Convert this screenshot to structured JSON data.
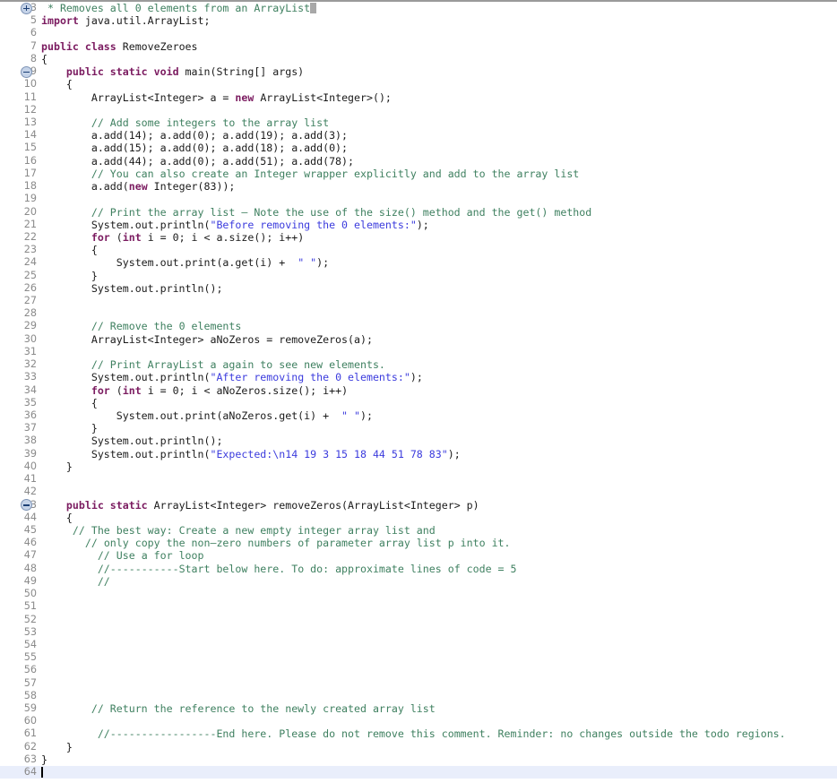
{
  "editor": {
    "language": "java",
    "colors": {
      "background": "#ffffff",
      "plain_text": "#1a1a1a",
      "keyword": "#7b1b60",
      "comment": "#3f8060",
      "string": "#3b3bdd",
      "line_number": "#8a8a8a",
      "current_line_highlight": "#e9eefb",
      "fold_marker": "#c5d3e8"
    },
    "caret_line": "64",
    "lines": [
      {
        "num": "3",
        "fold": "expand",
        "segments": [
          {
            "t": " * Removes all 0 elements from an ArrayList",
            "c": "cm"
          },
          {
            "t": "",
            "c": "cursor-block"
          }
        ]
      },
      {
        "num": "5",
        "fold": "",
        "segments": [
          {
            "t": "import",
            "c": "kw"
          },
          {
            "t": " java.util.ArrayList;",
            "c": "pl"
          }
        ]
      },
      {
        "num": "6",
        "fold": "",
        "segments": []
      },
      {
        "num": "7",
        "fold": "",
        "segments": [
          {
            "t": "public class",
            "c": "kw"
          },
          {
            "t": " RemoveZeroes",
            "c": "pl"
          }
        ]
      },
      {
        "num": "8",
        "fold": "",
        "segments": [
          {
            "t": "{",
            "c": "pl"
          }
        ]
      },
      {
        "num": "9",
        "fold": "collapse",
        "segments": [
          {
            "t": "    ",
            "c": "pl"
          },
          {
            "t": "public static void",
            "c": "kw"
          },
          {
            "t": " main(String[] args)",
            "c": "pl"
          }
        ]
      },
      {
        "num": "10",
        "fold": "",
        "segments": [
          {
            "t": "    {",
            "c": "pl"
          }
        ]
      },
      {
        "num": "11",
        "fold": "",
        "segments": [
          {
            "t": "        ArrayList<Integer> a = ",
            "c": "pl"
          },
          {
            "t": "new",
            "c": "kw"
          },
          {
            "t": " ArrayList<Integer>();",
            "c": "pl"
          }
        ]
      },
      {
        "num": "12",
        "fold": "",
        "segments": []
      },
      {
        "num": "13",
        "fold": "",
        "segments": [
          {
            "t": "        ",
            "c": "pl"
          },
          {
            "t": "// Add some integers to the array list",
            "c": "cm"
          }
        ]
      },
      {
        "num": "14",
        "fold": "",
        "segments": [
          {
            "t": "        a.add(14); a.add(0); a.add(19); a.add(3);",
            "c": "pl"
          }
        ]
      },
      {
        "num": "15",
        "fold": "",
        "segments": [
          {
            "t": "        a.add(15); a.add(0); a.add(18); a.add(0);",
            "c": "pl"
          }
        ]
      },
      {
        "num": "16",
        "fold": "",
        "segments": [
          {
            "t": "        a.add(44); a.add(0); a.add(51); a.add(78);",
            "c": "pl"
          }
        ]
      },
      {
        "num": "17",
        "fold": "",
        "segments": [
          {
            "t": "        ",
            "c": "pl"
          },
          {
            "t": "// You can also create an Integer wrapper explicitly and add to the array list",
            "c": "cm"
          }
        ]
      },
      {
        "num": "18",
        "fold": "",
        "segments": [
          {
            "t": "        a.add(",
            "c": "pl"
          },
          {
            "t": "new",
            "c": "kw"
          },
          {
            "t": " Integer(83));",
            "c": "pl"
          }
        ]
      },
      {
        "num": "19",
        "fold": "",
        "segments": []
      },
      {
        "num": "20",
        "fold": "",
        "segments": [
          {
            "t": "        ",
            "c": "pl"
          },
          {
            "t": "// Print the array list – Note the use of the size() method and the get() method",
            "c": "cm"
          }
        ]
      },
      {
        "num": "21",
        "fold": "",
        "segments": [
          {
            "t": "        System.out.println(",
            "c": "pl"
          },
          {
            "t": "\"Before removing the 0 elements:\"",
            "c": "str"
          },
          {
            "t": ");",
            "c": "pl"
          }
        ]
      },
      {
        "num": "22",
        "fold": "",
        "segments": [
          {
            "t": "        ",
            "c": "pl"
          },
          {
            "t": "for",
            "c": "kw"
          },
          {
            "t": " (",
            "c": "pl"
          },
          {
            "t": "int",
            "c": "kw"
          },
          {
            "t": " i = 0; i < a.size(); i++)",
            "c": "pl"
          }
        ]
      },
      {
        "num": "23",
        "fold": "",
        "segments": [
          {
            "t": "        {",
            "c": "pl"
          }
        ]
      },
      {
        "num": "24",
        "fold": "",
        "segments": [
          {
            "t": "            System.out.print(a.get(i) +  ",
            "c": "pl"
          },
          {
            "t": "\" \"",
            "c": "str"
          },
          {
            "t": ");",
            "c": "pl"
          }
        ]
      },
      {
        "num": "25",
        "fold": "",
        "segments": [
          {
            "t": "        }",
            "c": "pl"
          }
        ]
      },
      {
        "num": "26",
        "fold": "",
        "segments": [
          {
            "t": "        System.out.println();",
            "c": "pl"
          }
        ]
      },
      {
        "num": "27",
        "fold": "",
        "segments": []
      },
      {
        "num": "28",
        "fold": "",
        "segments": []
      },
      {
        "num": "29",
        "fold": "",
        "segments": [
          {
            "t": "        ",
            "c": "pl"
          },
          {
            "t": "// Remove the 0 elements",
            "c": "cm"
          }
        ]
      },
      {
        "num": "30",
        "fold": "",
        "segments": [
          {
            "t": "        ArrayList<Integer> aNoZeros = removeZeros(a);",
            "c": "pl"
          }
        ]
      },
      {
        "num": "31",
        "fold": "",
        "segments": []
      },
      {
        "num": "32",
        "fold": "",
        "segments": [
          {
            "t": "        ",
            "c": "pl"
          },
          {
            "t": "// Print ArrayList a again to see new elements.",
            "c": "cm"
          }
        ]
      },
      {
        "num": "33",
        "fold": "",
        "segments": [
          {
            "t": "        System.out.println(",
            "c": "pl"
          },
          {
            "t": "\"After removing the 0 elements:\"",
            "c": "str"
          },
          {
            "t": ");",
            "c": "pl"
          }
        ]
      },
      {
        "num": "34",
        "fold": "",
        "segments": [
          {
            "t": "        ",
            "c": "pl"
          },
          {
            "t": "for",
            "c": "kw"
          },
          {
            "t": " (",
            "c": "pl"
          },
          {
            "t": "int",
            "c": "kw"
          },
          {
            "t": " i = 0; i < aNoZeros.size(); i++)",
            "c": "pl"
          }
        ]
      },
      {
        "num": "35",
        "fold": "",
        "segments": [
          {
            "t": "        {",
            "c": "pl"
          }
        ]
      },
      {
        "num": "36",
        "fold": "",
        "segments": [
          {
            "t": "            System.out.print(aNoZeros.get(i) +  ",
            "c": "pl"
          },
          {
            "t": "\" \"",
            "c": "str"
          },
          {
            "t": ");",
            "c": "pl"
          }
        ]
      },
      {
        "num": "37",
        "fold": "",
        "segments": [
          {
            "t": "        }",
            "c": "pl"
          }
        ]
      },
      {
        "num": "38",
        "fold": "",
        "segments": [
          {
            "t": "        System.out.println();",
            "c": "pl"
          }
        ]
      },
      {
        "num": "39",
        "fold": "",
        "segments": [
          {
            "t": "        System.out.println(",
            "c": "pl"
          },
          {
            "t": "\"Expected:\\n14 19 3 15 18 44 51 78 83\"",
            "c": "str"
          },
          {
            "t": ");",
            "c": "pl"
          }
        ]
      },
      {
        "num": "40",
        "fold": "",
        "segments": [
          {
            "t": "    }",
            "c": "pl"
          }
        ]
      },
      {
        "num": "41",
        "fold": "",
        "segments": []
      },
      {
        "num": "42",
        "fold": "",
        "segments": []
      },
      {
        "num": "43",
        "fold": "collapse",
        "segments": [
          {
            "t": "    ",
            "c": "pl"
          },
          {
            "t": "public static",
            "c": "kw"
          },
          {
            "t": " ArrayList<Integer> removeZeros(ArrayList<Integer> p)",
            "c": "pl"
          }
        ]
      },
      {
        "num": "44",
        "fold": "",
        "segments": [
          {
            "t": "    {",
            "c": "pl"
          }
        ]
      },
      {
        "num": "45",
        "fold": "",
        "segments": [
          {
            "t": "     ",
            "c": "pl"
          },
          {
            "t": "// The best way: Create a new empty integer array list and",
            "c": "cm"
          }
        ]
      },
      {
        "num": "46",
        "fold": "",
        "segments": [
          {
            "t": "       ",
            "c": "pl"
          },
          {
            "t": "// only copy the non–zero numbers of parameter array list p into it.",
            "c": "cm"
          }
        ]
      },
      {
        "num": "47",
        "fold": "",
        "segments": [
          {
            "t": "         ",
            "c": "pl"
          },
          {
            "t": "// Use a for loop",
            "c": "cm"
          }
        ]
      },
      {
        "num": "48",
        "fold": "",
        "segments": [
          {
            "t": "         ",
            "c": "pl"
          },
          {
            "t": "//-----------Start below here. To do: approximate lines of code = 5",
            "c": "cm"
          }
        ]
      },
      {
        "num": "49",
        "fold": "",
        "segments": [
          {
            "t": "         ",
            "c": "pl"
          },
          {
            "t": "//",
            "c": "cm"
          }
        ]
      },
      {
        "num": "50",
        "fold": "",
        "segments": []
      },
      {
        "num": "51",
        "fold": "",
        "segments": []
      },
      {
        "num": "52",
        "fold": "",
        "segments": []
      },
      {
        "num": "53",
        "fold": "",
        "segments": []
      },
      {
        "num": "54",
        "fold": "",
        "segments": []
      },
      {
        "num": "55",
        "fold": "",
        "segments": []
      },
      {
        "num": "56",
        "fold": "",
        "segments": []
      },
      {
        "num": "57",
        "fold": "",
        "segments": []
      },
      {
        "num": "58",
        "fold": "",
        "segments": []
      },
      {
        "num": "59",
        "fold": "",
        "segments": [
          {
            "t": "        ",
            "c": "pl"
          },
          {
            "t": "// Return the reference to the newly created array list",
            "c": "cm"
          }
        ]
      },
      {
        "num": "60",
        "fold": "",
        "segments": []
      },
      {
        "num": "61",
        "fold": "",
        "segments": [
          {
            "t": "         ",
            "c": "pl"
          },
          {
            "t": "//-----------------End here. Please do not remove this comment. Reminder: no changes outside the todo regions.",
            "c": "cm"
          }
        ]
      },
      {
        "num": "62",
        "fold": "",
        "segments": [
          {
            "t": "    }",
            "c": "pl"
          }
        ]
      },
      {
        "num": "63",
        "fold": "",
        "segments": [
          {
            "t": "}",
            "c": "pl"
          }
        ]
      },
      {
        "num": "64",
        "fold": "",
        "segments": [],
        "current": true,
        "caret": true
      }
    ]
  }
}
